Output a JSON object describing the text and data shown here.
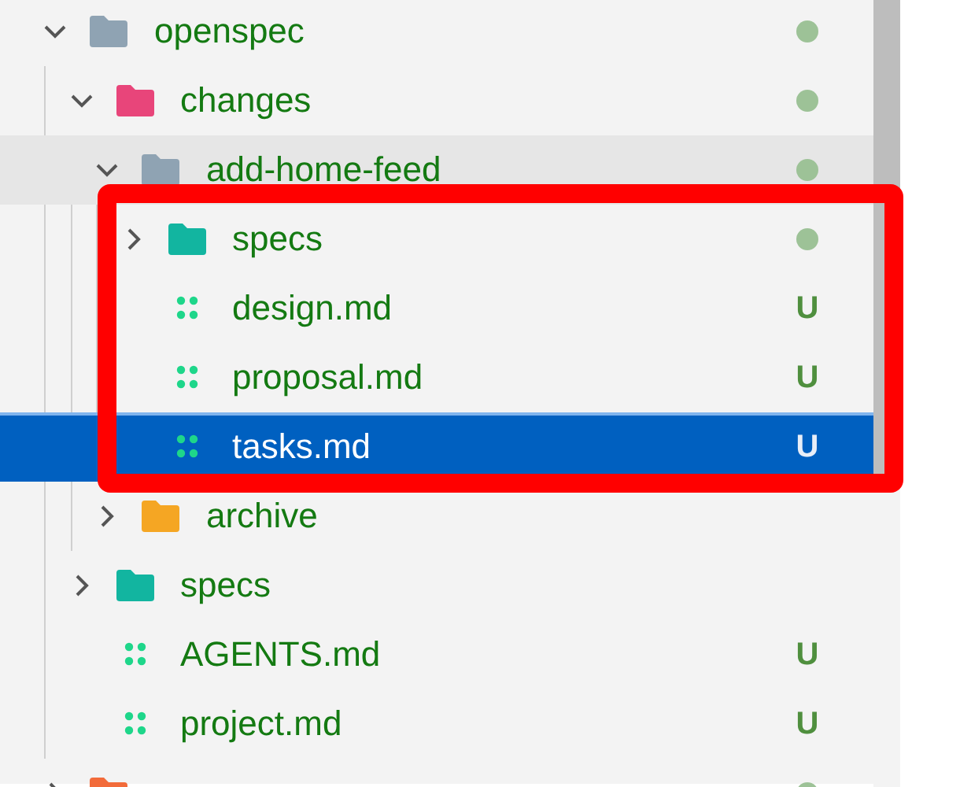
{
  "explorer": {
    "items": [
      {
        "kind": "folder",
        "name": "openspec",
        "color": "#8fa3b3",
        "expanded": true,
        "has_changes": true,
        "selected": false,
        "hovered": false,
        "children": [
          {
            "kind": "folder",
            "name": "changes",
            "color": "#e8457a",
            "expanded": true,
            "has_changes": true,
            "selected": false,
            "hovered": false,
            "children": [
              {
                "kind": "folder",
                "name": "add-home-feed",
                "color": "#8fa3b3",
                "expanded": true,
                "has_changes": true,
                "selected": false,
                "hovered": true,
                "children_circled": true,
                "children": [
                  {
                    "kind": "folder",
                    "name": "specs",
                    "color": "#12b5a0",
                    "expanded": false,
                    "has_changes": true,
                    "selected": false,
                    "hovered": false
                  },
                  {
                    "kind": "file",
                    "name": "design.md",
                    "status": "U",
                    "selected": false,
                    "hovered": false
                  },
                  {
                    "kind": "file",
                    "name": "proposal.md",
                    "status": "U",
                    "selected": false,
                    "hovered": false
                  },
                  {
                    "kind": "file",
                    "name": "tasks.md",
                    "status": "U",
                    "selected": true,
                    "hovered": false
                  }
                ]
              },
              {
                "kind": "folder",
                "name": "archive",
                "color": "#f5a623",
                "expanded": false,
                "has_changes": false,
                "selected": false,
                "hovered": false
              }
            ]
          },
          {
            "kind": "folder",
            "name": "specs",
            "color": "#12b5a0",
            "expanded": false,
            "has_changes": false,
            "selected": false,
            "hovered": false
          },
          {
            "kind": "file",
            "name": "AGENTS.md",
            "status": "U",
            "selected": false,
            "hovered": false
          },
          {
            "kind": "file",
            "name": "project.md",
            "status": "U",
            "selected": false,
            "hovered": false
          }
        ]
      },
      {
        "kind": "folder",
        "color": "#f26b3a",
        "expanded": false,
        "has_changes": true,
        "selected": false,
        "hovered": false
      }
    ]
  }
}
